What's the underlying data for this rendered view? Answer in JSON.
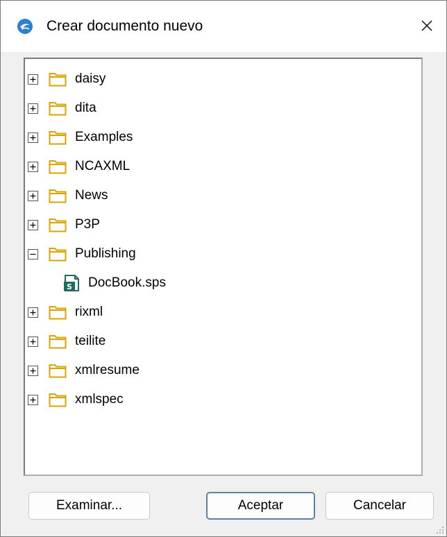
{
  "dialog": {
    "title": "Crear documento nuevo"
  },
  "tree": {
    "items": [
      {
        "label": "daisy",
        "expanded": false
      },
      {
        "label": "dita",
        "expanded": false
      },
      {
        "label": "Examples",
        "expanded": false
      },
      {
        "label": "NCAXML",
        "expanded": false
      },
      {
        "label": "News",
        "expanded": false
      },
      {
        "label": "P3P",
        "expanded": false
      },
      {
        "label": "Publishing",
        "expanded": true
      },
      {
        "label": "DocBook.sps",
        "type": "file"
      },
      {
        "label": "rixml",
        "expanded": false
      },
      {
        "label": "teilite",
        "expanded": false
      },
      {
        "label": "xmlresume",
        "expanded": false
      },
      {
        "label": "xmlspec",
        "expanded": false
      }
    ]
  },
  "buttons": {
    "browse": "Examinar...",
    "ok": "Aceptar",
    "cancel": "Cancelar"
  },
  "colors": {
    "folder_outline": "#d9a400",
    "folder_fill": "#ffffff",
    "app_icon": "#2b7fd4",
    "file_icon": "#1f6b5e"
  }
}
